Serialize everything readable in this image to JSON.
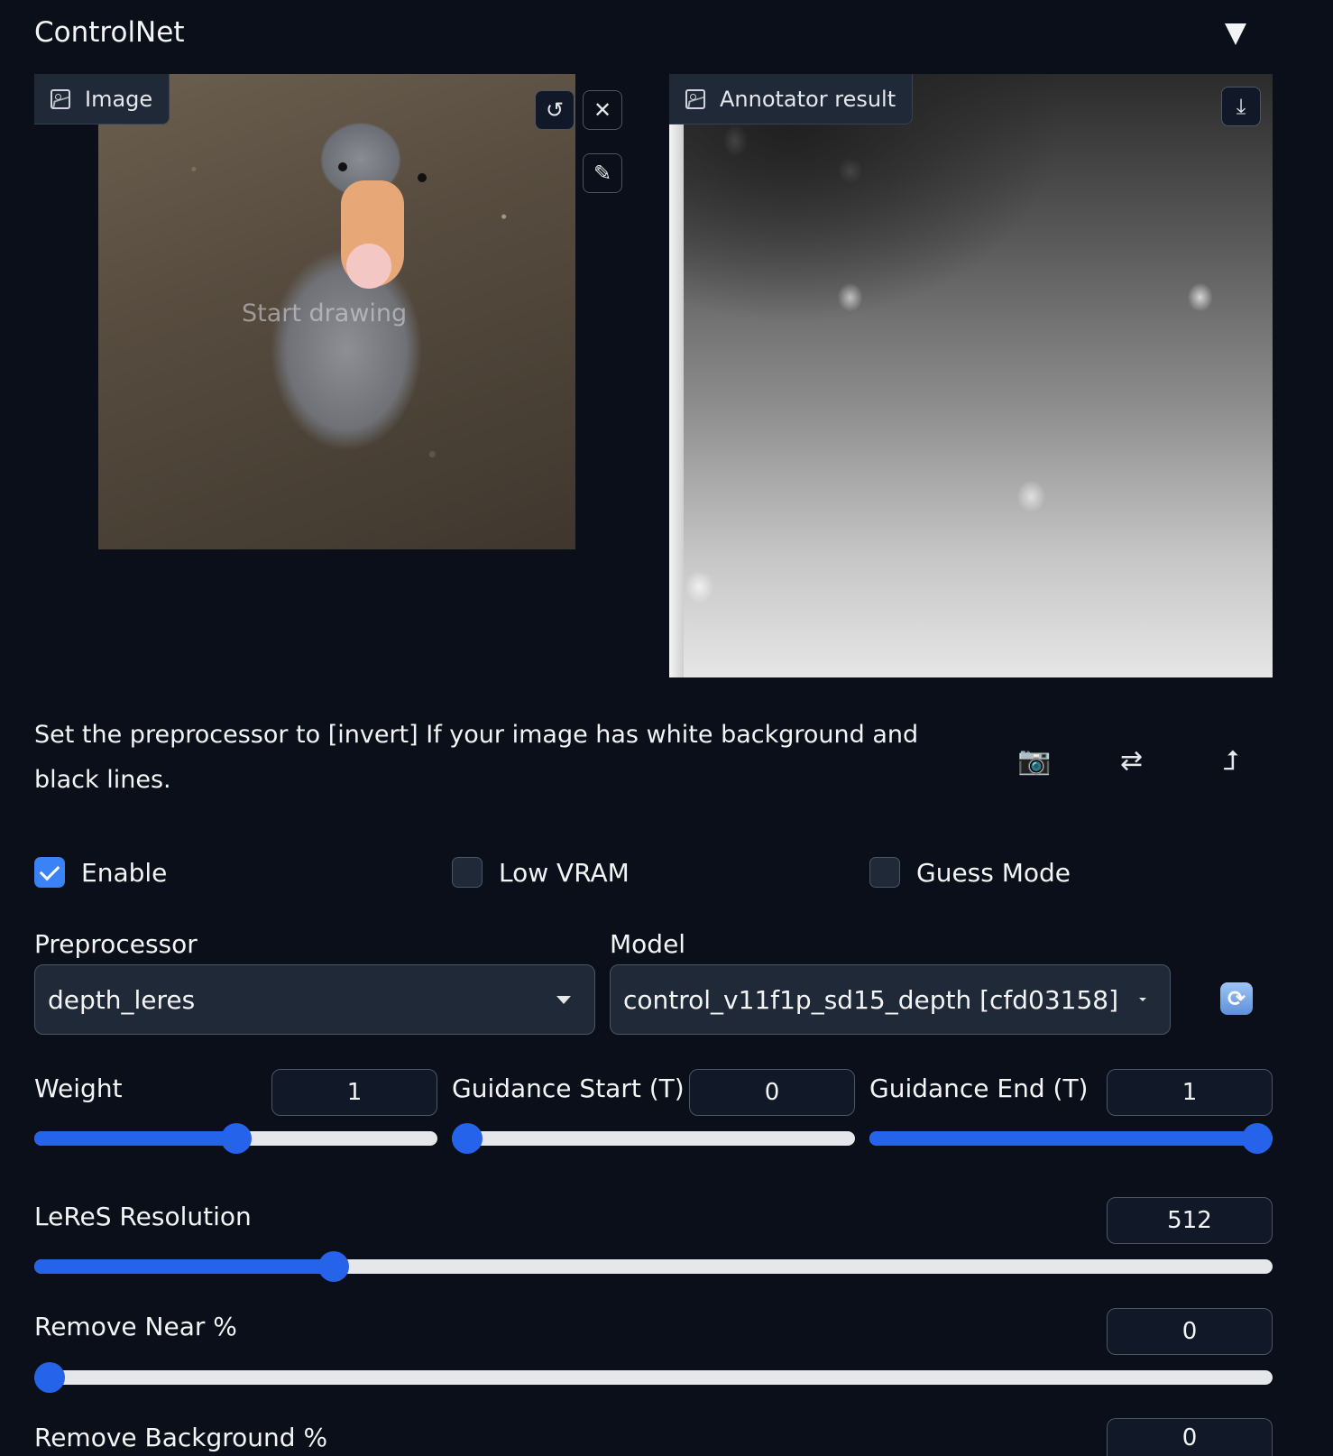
{
  "header": {
    "title": "ControlNet"
  },
  "image_panel": {
    "label": "Image",
    "watermark": "Start drawing"
  },
  "annotator_panel": {
    "label": "Annotator result"
  },
  "note": "Set the preprocessor to [invert] If your image has white background and black lines.",
  "tools": {
    "camera": "📷",
    "swap": "⇄",
    "upload": "⮥"
  },
  "checkboxes": [
    {
      "label": "Enable",
      "checked": true
    },
    {
      "label": "Low VRAM",
      "checked": false
    },
    {
      "label": "Guess Mode",
      "checked": false
    }
  ],
  "preprocessor": {
    "label": "Preprocessor",
    "value": "depth_leres"
  },
  "model": {
    "label": "Model",
    "value": "control_v11f1p_sd15_depth [cfd03158]"
  },
  "sliders": {
    "weight": {
      "label": "Weight",
      "value": "1",
      "fraction": 0.5
    },
    "guidance_start": {
      "label": "Guidance Start (T)",
      "value": "0",
      "fraction": 0
    },
    "guidance_end": {
      "label": "Guidance End (T)",
      "value": "1",
      "fraction": 1
    },
    "leres_resolution": {
      "label": "LeReS Resolution",
      "value": "512",
      "fraction": 0.235
    },
    "remove_near": {
      "label": "Remove Near %",
      "value": "0",
      "fraction": 0
    },
    "remove_background": {
      "label": "Remove Background %",
      "value": "0",
      "fraction": 0
    }
  },
  "colors": {
    "accent": "#2563eb",
    "background": "#0b0f19",
    "panel": "#1f2937"
  }
}
